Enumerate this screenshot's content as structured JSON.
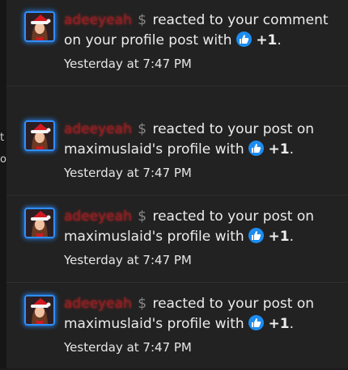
{
  "background_fragments": [
    "t",
    "o"
  ],
  "notifications": [
    {
      "username": "adeeyeah",
      "dollar_icon": "$",
      "pre_text": "reacted to your comment on your profile post with",
      "reaction": "+1",
      "time": "Yesterday at 7:47 PM"
    },
    {
      "username": "adeeyeah",
      "dollar_icon": "$",
      "pre_text": "reacted to your post on maximuslaid's profile with",
      "reaction": "+1",
      "time": "Yesterday at 7:47 PM"
    },
    {
      "username": "adeeyeah",
      "dollar_icon": "$",
      "pre_text": "reacted to your post on maximuslaid's profile with",
      "reaction": "+1",
      "time": "Yesterday at 7:47 PM"
    },
    {
      "username": "adeeyeah",
      "dollar_icon": "$",
      "pre_text": "reacted to your post on maximuslaid's profile with",
      "reaction": "+1",
      "time": "Yesterday at 7:47 PM"
    }
  ],
  "colors": {
    "panel_bg": "#222222",
    "username_glow": "#dc2828",
    "avatar_border": "#2f8fff",
    "like_badge": "#1d8cf0"
  }
}
